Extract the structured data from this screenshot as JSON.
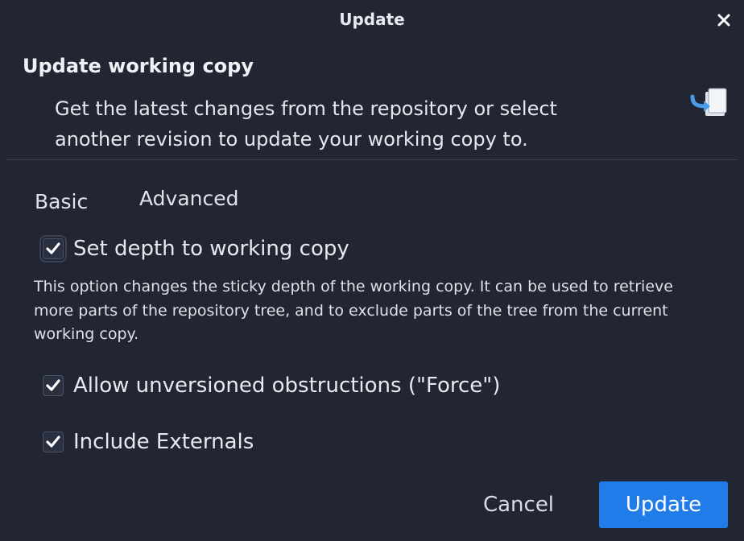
{
  "window": {
    "title": "Update",
    "close_icon": "close-icon"
  },
  "header": {
    "title": "Update working copy",
    "description_line1": "Get the latest changes from the repository or select",
    "description_line2": "another revision to update your working copy to.",
    "icon": "update-working-copy-icon"
  },
  "tabs": [
    {
      "label": "Basic",
      "selected": false
    },
    {
      "label": "Advanced",
      "selected": true
    }
  ],
  "options": {
    "depth": {
      "label": "Set depth to working copy",
      "checked": true,
      "description": "This option changes the sticky depth of the working copy. It can be used to retrieve more parts of the repository tree, and to exclude parts of the tree from the current working copy."
    },
    "force": {
      "label": "Allow unversioned obstructions (\"Force\")",
      "checked": true
    },
    "externals": {
      "label": "Include Externals",
      "checked": true
    }
  },
  "buttons": {
    "cancel": "Cancel",
    "update": "Update"
  },
  "colors": {
    "background": "#222632",
    "accent": "#1f7ce8",
    "icon_blue": "#4a9bea",
    "text": "#e6e9ef"
  }
}
